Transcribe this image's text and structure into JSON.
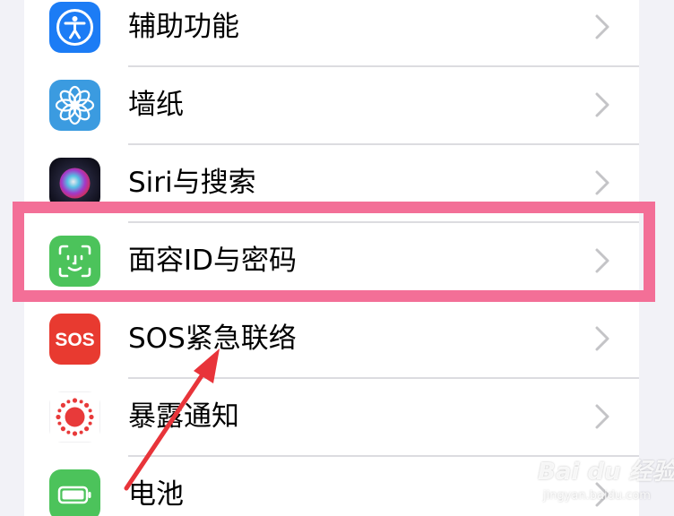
{
  "settings": {
    "items": [
      {
        "label": "辅助功能",
        "icon": "accessibility-icon",
        "color": "#1c7cf5"
      },
      {
        "label": "墙纸",
        "icon": "wallpaper-flower-icon",
        "color": "#3b9be0"
      },
      {
        "label": "Siri与搜索",
        "icon": "siri-icon",
        "color": "#1a1a2e"
      },
      {
        "label": "面容ID与密码",
        "icon": "face-id-icon",
        "color": "#4cc35b"
      },
      {
        "label": "SOS紧急联络",
        "icon": "sos-icon",
        "color": "#e83a30",
        "icon_text": "SOS"
      },
      {
        "label": "暴露通知",
        "icon": "exposure-notification-icon",
        "color": "#e83a3a"
      },
      {
        "label": "电池",
        "icon": "battery-icon",
        "color": "#4cc35b"
      }
    ]
  },
  "annotation": {
    "highlight_color": "#f36f97",
    "arrow_color": "#e8343a"
  },
  "watermark": {
    "brand": "Bai du 经验",
    "url": "jingyan.baidu.com"
  }
}
